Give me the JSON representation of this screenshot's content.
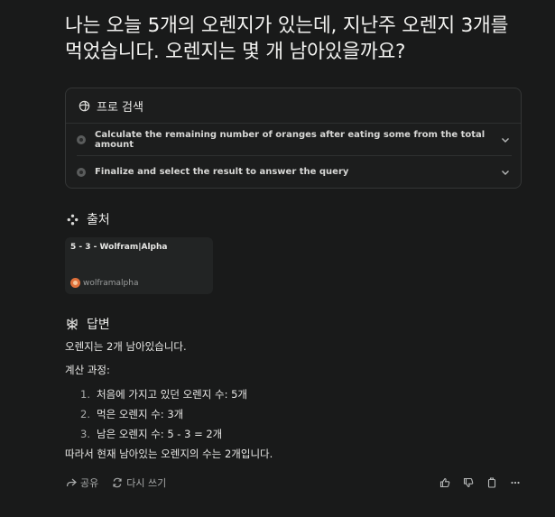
{
  "question": "나는 오늘 5개의 오렌지가 있는데, 지난주 오렌지 3개를 먹었습니다. 오렌지는 몇 개 남아있을까요?",
  "pro_search": {
    "title": "프로 검색",
    "steps": [
      {
        "label": "Calculate the remaining number of oranges after eating some from the total amount"
      },
      {
        "label": "Finalize and select the result to answer the query"
      }
    ]
  },
  "sources": {
    "title": "출처",
    "items": [
      {
        "title": "5 - 3 - Wolfram|Alpha",
        "site": "wolframalpha"
      }
    ]
  },
  "answer": {
    "title": "답변",
    "summary": "오렌지는 2개 남아있습니다.",
    "steps_heading": "계산 과정:",
    "steps": [
      {
        "num": "1.",
        "text": "처음에 가지고 있던 오렌지 수: 5개"
      },
      {
        "num": "2.",
        "text": "먹은 오렌지 수: 3개"
      },
      {
        "num": "3.",
        "text": "남은 오렌지 수: 5 - 3 = 2개"
      }
    ],
    "conclusion": "따라서 현재 남아있는 오렌지의 수는 2개입니다."
  },
  "actions": {
    "share_label": "공유",
    "rewrite_label": "다시 쓰기"
  },
  "icons": {
    "pro": "pro-search-icon",
    "sources": "sources-icon",
    "answer": "answer-icon",
    "share": "share-icon",
    "rewrite": "rewrite-icon",
    "thumbs_up": "thumbs-up-icon",
    "thumbs_down": "thumbs-down-icon",
    "copy": "copy-icon",
    "more": "more-icon",
    "chevron": "chevron-down-icon"
  }
}
